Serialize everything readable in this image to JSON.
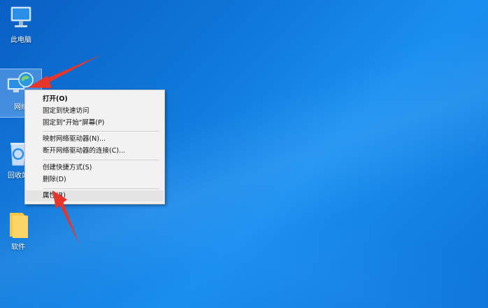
{
  "desktop": {
    "icons": [
      {
        "label": "此电脑",
        "icon": "this-pc-icon"
      },
      {
        "label": "网络",
        "icon": "network-icon"
      },
      {
        "label": "回收站",
        "icon": "recycle-bin-icon"
      },
      {
        "label": "软件",
        "icon": "folder-icon"
      }
    ]
  },
  "context_menu": {
    "items": [
      {
        "label": "打开(O)"
      },
      {
        "label": "固定到快速访问"
      },
      {
        "label": "固定到\"开始\"屏幕(P)"
      },
      {
        "label": "映射网络驱动器(N)..."
      },
      {
        "label": "断开网络驱动器的连接(C)..."
      },
      {
        "label": "创建快捷方式(S)"
      },
      {
        "label": "删除(D)"
      },
      {
        "label": "属性(R)"
      }
    ]
  },
  "colors": {
    "annotation_arrow": "#e8352a"
  }
}
